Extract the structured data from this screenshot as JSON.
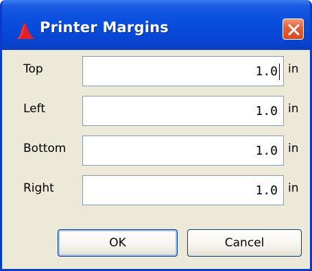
{
  "window": {
    "title": "Printer Margins",
    "icon": "app-logo-icon",
    "close_icon": "close-icon"
  },
  "fields": [
    {
      "label": "Top",
      "value": "1.0",
      "unit": "in",
      "focused": true
    },
    {
      "label": "Left",
      "value": "1.0",
      "unit": "in",
      "focused": false
    },
    {
      "label": "Bottom",
      "value": "1.0",
      "unit": "in",
      "focused": false
    },
    {
      "label": "Right",
      "value": "1.0",
      "unit": "in",
      "focused": false
    }
  ],
  "buttons": {
    "ok_label": "OK",
    "cancel_label": "Cancel"
  },
  "colors": {
    "titlebar": "#0a4fe0",
    "dialog_background": "#ece9d8",
    "close_button": "#e5603a"
  }
}
